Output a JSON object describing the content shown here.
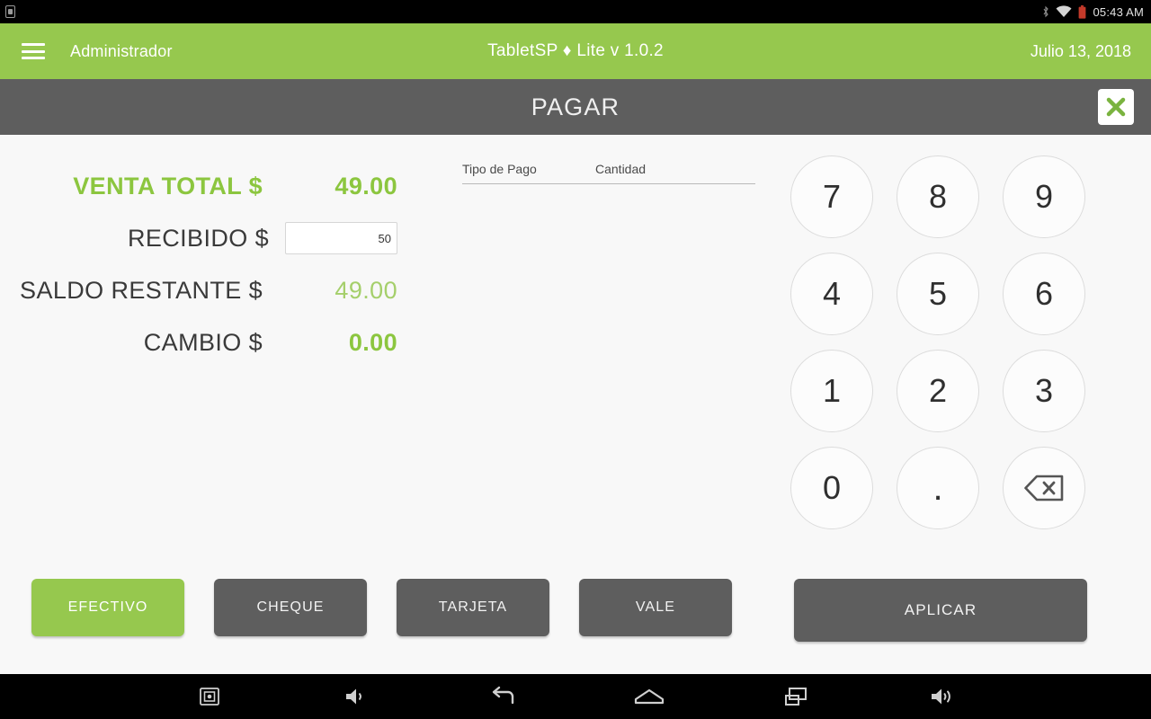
{
  "status_bar": {
    "clock": "05:43 AM",
    "left_icons": [
      "sim-card-icon"
    ],
    "right_icons": [
      "bluetooth-icon",
      "wifi-icon",
      "battery-icon"
    ]
  },
  "app_bar": {
    "menu_icon": "hamburger-menu-icon",
    "user": "Administrador",
    "title": "TabletSP ♦ Lite v 1.0.2",
    "date": "Julio 13, 2018",
    "background_color": "#96c84e"
  },
  "sub_header": {
    "title": "PAGAR",
    "close_icon": "close-icon",
    "background_color": "#5e5e5e",
    "close_icon_color": "#7ab33f"
  },
  "totals": [
    {
      "label": "VENTA TOTAL $",
      "value": "49.00",
      "style": "total"
    },
    {
      "label": "RECIBIDO $",
      "value": "",
      "style": "input"
    },
    {
      "label": "SALDO RESTANTE $",
      "value": "49.00",
      "style": "saldo"
    },
    {
      "label": "CAMBIO $",
      "value": "0.00",
      "style": "cambio"
    }
  ],
  "recibido_input": {
    "value": "50",
    "placeholder": ""
  },
  "payments_table": {
    "columns": [
      "Tipo de Pago",
      "Cantidad"
    ],
    "rows": []
  },
  "keypad": {
    "keys": [
      "7",
      "8",
      "9",
      "4",
      "5",
      "6",
      "1",
      "2",
      "3",
      "0",
      "."
    ],
    "backspace_icon": "backspace-icon"
  },
  "payment_methods": [
    {
      "label": "EFECTIVO",
      "selected": true
    },
    {
      "label": "CHEQUE",
      "selected": false
    },
    {
      "label": "TARJETA",
      "selected": false
    },
    {
      "label": "VALE",
      "selected": false
    }
  ],
  "apply_button": {
    "label": "APLICAR"
  },
  "nav_bar": {
    "buttons": [
      "screenshot-icon",
      "volume-down-icon",
      "back-icon",
      "home-icon",
      "recents-icon",
      "volume-up-icon"
    ]
  },
  "colors": {
    "brand_green": "#96c84e",
    "value_green": "#8cc63f",
    "muted_green": "#a5cf6b",
    "gray_bar": "#5e5e5e",
    "body_bg": "#f8f8f8"
  }
}
